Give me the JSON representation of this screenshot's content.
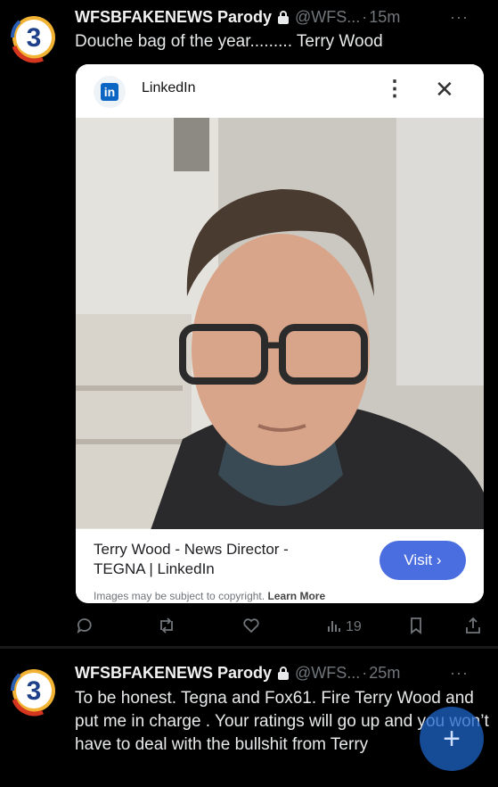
{
  "tweets": [
    {
      "author_name": "WFSBFAKENEWS Parody",
      "handle": "@WFS...",
      "separator": "·",
      "time": "15m",
      "more": "···",
      "text": "Douche bag of the year......... Terry Wood",
      "card": {
        "site": "LinkedIn",
        "menu_icon": "⋮",
        "close_icon": "✕",
        "title_line1": "Terry Wood - News Director -",
        "title_line2": "TEGNA | LinkedIn",
        "visit_label": "Visit ›",
        "copyright": "Images may be subject to copyright.",
        "learn_more": "Learn More"
      },
      "actions": {
        "reply": "",
        "retweet": "",
        "like": "",
        "views": "19",
        "bookmark": "",
        "share": ""
      }
    },
    {
      "author_name": "WFSBFAKENEWS Parody",
      "handle": "@WFS...",
      "separator": "·",
      "time": "25m",
      "more": "···",
      "text": "To be honest. Tegna and Fox61. Fire Terry Wood and put me in charge . Your ratings will go up and you won’t have to deal with the bullshit from Terry"
    }
  ],
  "fab_label": "+",
  "colors": {
    "background": "#000000",
    "muted": "#71767b",
    "visit_button": "#4a6ee0",
    "linkedin_blue": "#0a66c2",
    "fab": "#1d64c8"
  }
}
